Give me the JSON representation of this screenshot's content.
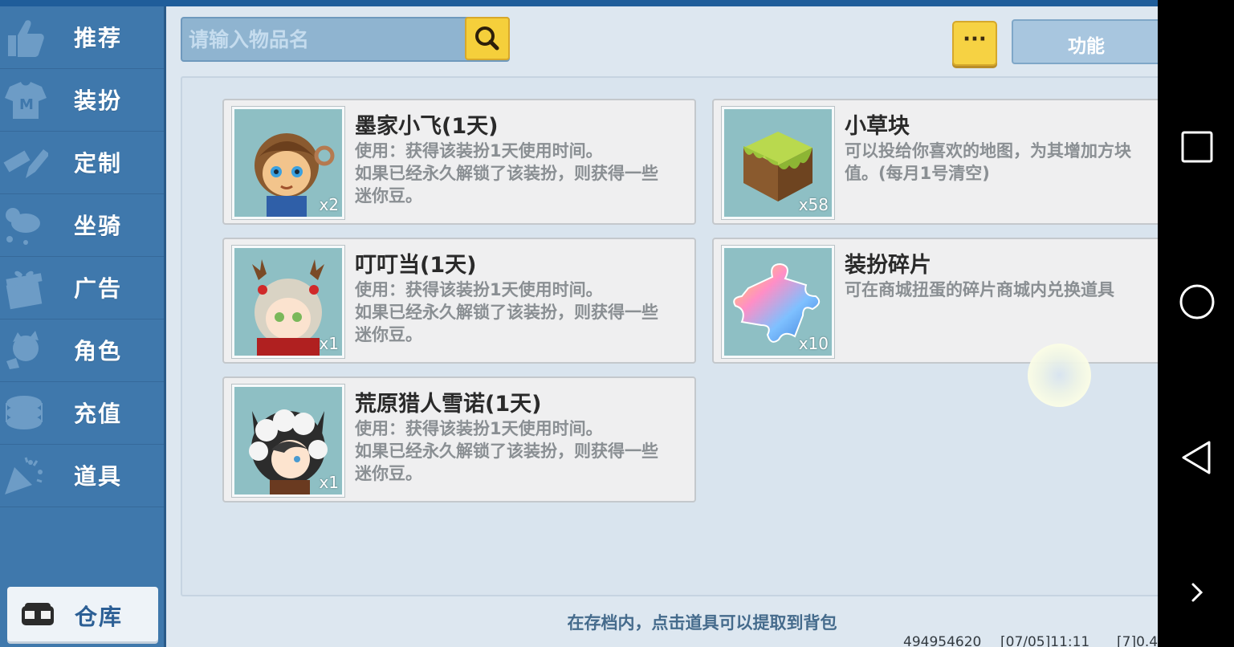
{
  "sidebar": {
    "items": [
      {
        "label": "推荐",
        "icon": "thumbs-up-icon"
      },
      {
        "label": "装扮",
        "icon": "shirt-icon"
      },
      {
        "label": "定制",
        "icon": "pencil-ruler-icon"
      },
      {
        "label": "坐骑",
        "icon": "mount-icon"
      },
      {
        "label": "广告",
        "icon": "gift-icon"
      },
      {
        "label": "角色",
        "icon": "character-icon"
      },
      {
        "label": "充值",
        "icon": "coin-stack-icon"
      },
      {
        "label": "道具",
        "icon": "party-popper-icon"
      }
    ],
    "warehouse": {
      "label": "仓库",
      "icon": "chest-icon"
    }
  },
  "toolbar": {
    "search_placeholder": "请输入物品名",
    "more_label": "···",
    "function_label": "功能"
  },
  "items": [
    {
      "name": "墨家小飞(1天)",
      "desc": "使用：获得该装扮1天使用时间。\n  如果已经永久解锁了该装扮，则获得一些迷你豆。",
      "qty": "x2"
    },
    {
      "name": "小草块",
      "desc": "可以投给你喜欢的地图，为其增加方块值。(每月1号清空)",
      "qty": "x58"
    },
    {
      "name": "叮叮当(1天)",
      "desc": "使用：获得该装扮1天使用时间。\n  如果已经永久解锁了该装扮，则获得一些迷你豆。",
      "qty": "x1"
    },
    {
      "name": "装扮碎片",
      "desc": "可在商城扭蛋的碎片商城内兑换道具",
      "qty": "x10"
    },
    {
      "name": "荒原猎人雪诺(1天)",
      "desc": "使用：获得该装扮1天使用时间。\n  如果已经永久解锁了该装扮，则获得一些迷你豆。",
      "qty": "x1"
    }
  ],
  "footer": {
    "hint": "在存档内，点击道具可以提取到背包",
    "user_id": "494954620",
    "time": "[07/05]11:11",
    "version": "[7]0.4"
  },
  "colors": {
    "sidebar_bg": "#3f78ac",
    "main_bg": "#dde7f0",
    "accent_yellow": "#f6d243",
    "card_bg": "#efeff0"
  }
}
